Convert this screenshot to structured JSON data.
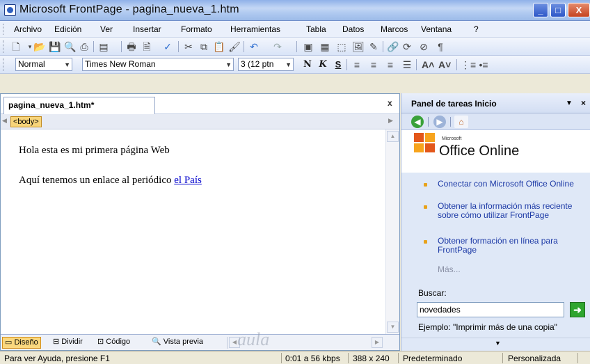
{
  "window": {
    "title": "Microsoft FrontPage - pagina_nueva_1.htm",
    "min_label": "_",
    "max_label": "□",
    "close_label": "X"
  },
  "menu": {
    "items": [
      "Archivo",
      "Edición",
      "Ver",
      "Insertar",
      "Formato",
      "Herramientas",
      "Tabla",
      "Datos",
      "Marcos",
      "Ventana",
      "?"
    ]
  },
  "format_toolbar": {
    "style": "Normal",
    "font": "Times New Roman",
    "size": "3 (12 ptn",
    "bold": "N",
    "italic": "K",
    "underline": "S"
  },
  "document": {
    "tab_title": "pagina_nueva_1.htm*",
    "close_label": "x",
    "tag": "<body>",
    "paragraph1": "Hola esta es mi primera página Web",
    "paragraph2_text": "Aquí tenemos un enlace al periódico",
    "link_text": "el País",
    "view_tabs": [
      "Diseño",
      "Dividir",
      "Código",
      "Vista previa"
    ],
    "watermark": "aula"
  },
  "task_pane": {
    "title": "Panel de tareas Inicio",
    "logo_small": "Microsoft",
    "logo_text": "Office Online",
    "links": [
      "Conectar con Microsoft Office Online",
      "Obtener la información más reciente sobre cómo utilizar FrontPage",
      "Obtener formación en línea para FrontPage"
    ],
    "more": "Más...",
    "search_label": "Buscar:",
    "search_value": "novedades",
    "example": "Ejemplo: \"Imprimir más de una copia\""
  },
  "status": {
    "help": "Para ver Ayuda, presione F1",
    "speed": "0:01 a 56 kbps",
    "dimensions": "388 x 240",
    "mode1": "Predeterminado",
    "mode2": "Personalizada"
  }
}
